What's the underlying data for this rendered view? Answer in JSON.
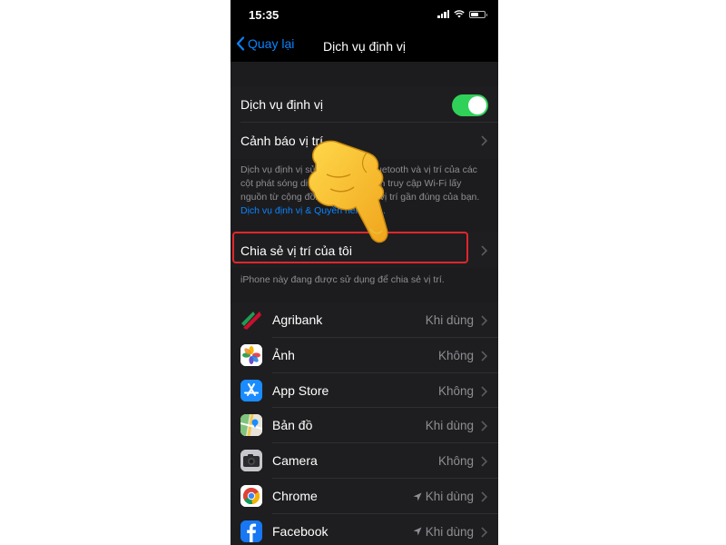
{
  "status": {
    "time": "15:35"
  },
  "nav": {
    "back_label": "Quay lại",
    "title": "Dịch vụ định vị"
  },
  "settings": {
    "location_services_label": "Dịch vụ định vị",
    "location_services_on": true,
    "location_alerts_label": "Cảnh báo vị trí",
    "description_text": "Dịch vụ định vị sử dụng GPS, Bluetooth và vị trí của các cột phát sóng di động và các điểm truy cập Wi-Fi lấy nguồn từ cộng đồng để xác định vị trí gần đúng của bạn.",
    "description_link": "Dịch vụ định vị & Quyền riêng tư...",
    "share_location_label": "Chia sẻ vị trí của tôi",
    "share_location_note": "iPhone này đang được sử dụng để chia sẻ vị trí."
  },
  "apps": [
    {
      "name": "Agribank",
      "value": "Khi dùng",
      "icon": "agribank-icon",
      "arrow": false
    },
    {
      "name": "Ảnh",
      "value": "Không",
      "icon": "photos-icon",
      "arrow": false
    },
    {
      "name": "App Store",
      "value": "Không",
      "icon": "app-store-icon",
      "arrow": false
    },
    {
      "name": "Bản đồ",
      "value": "Khi dùng",
      "icon": "maps-icon",
      "arrow": false
    },
    {
      "name": "Camera",
      "value": "Không",
      "icon": "camera-icon",
      "arrow": false
    },
    {
      "name": "Chrome",
      "value": "Khi dùng",
      "icon": "chrome-icon",
      "arrow": true
    },
    {
      "name": "Facebook",
      "value": "Khi dùng",
      "icon": "facebook-icon",
      "arrow": true
    }
  ],
  "colors": {
    "accent": "#0a84ff",
    "toggle_on": "#30d158",
    "highlight": "#e0262c",
    "background": "#000000",
    "cell": "#1e1e20"
  }
}
